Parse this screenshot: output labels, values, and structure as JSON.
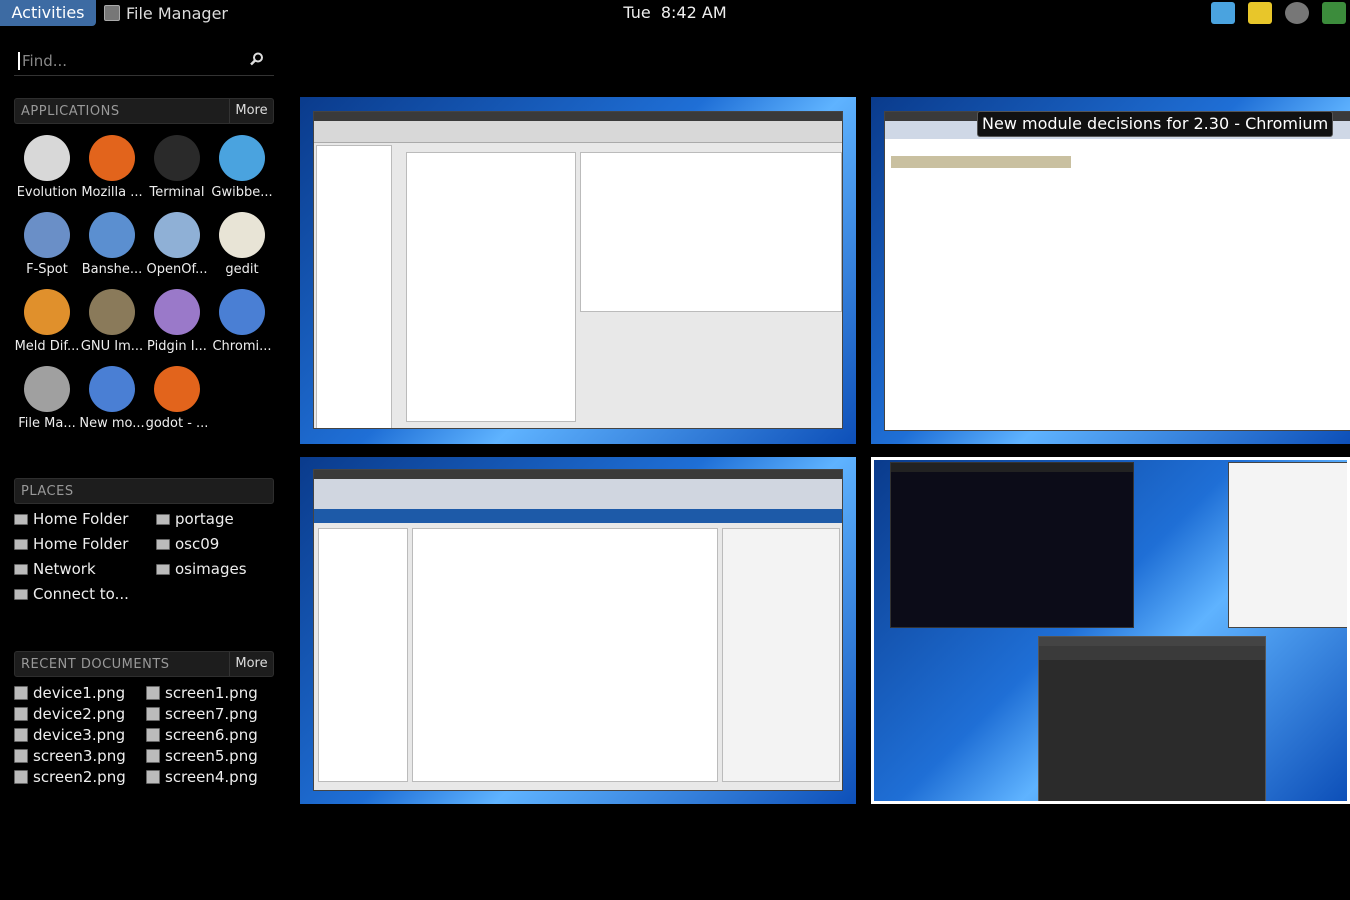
{
  "topbar": {
    "activities": "Activities",
    "app_menu": "File Manager",
    "day": "Tue",
    "time": "8:42 AM"
  },
  "search": {
    "placeholder": "Find..."
  },
  "applications": {
    "heading": "APPLICATIONS",
    "more": "More",
    "items": [
      {
        "label": "Evolution",
        "icon": "evolution-icon",
        "color": "#d8d8d8"
      },
      {
        "label": "Mozilla ...",
        "icon": "firefox-icon",
        "color": "#e2641c"
      },
      {
        "label": "Terminal",
        "icon": "terminal-icon",
        "color": "#2a2a2a"
      },
      {
        "label": "Gwibbe...",
        "icon": "gwibber-icon",
        "color": "#4aa3df"
      },
      {
        "label": "F-Spot",
        "icon": "fspot-icon",
        "color": "#6a8fc7"
      },
      {
        "label": "Banshe...",
        "icon": "banshee-icon",
        "color": "#5b8fd0"
      },
      {
        "label": "OpenOf...",
        "icon": "openoffice-icon",
        "color": "#8fb0d6"
      },
      {
        "label": "gedit",
        "icon": "gedit-icon",
        "color": "#e8e4d6"
      },
      {
        "label": "Meld Dif...",
        "icon": "meld-icon",
        "color": "#e0902c"
      },
      {
        "label": "GNU Im...",
        "icon": "gimp-icon",
        "color": "#8a7a5a"
      },
      {
        "label": "Pidgin I...",
        "icon": "pidgin-icon",
        "color": "#9a79c9"
      },
      {
        "label": "Chromi...",
        "icon": "chromium-icon",
        "color": "#4a7fd4"
      },
      {
        "label": "File Ma...",
        "icon": "file-manager-icon",
        "color": "#a0a0a0"
      },
      {
        "label": "New mo...",
        "icon": "chromium-icon",
        "color": "#4a7fd4"
      },
      {
        "label": "godot - ...",
        "icon": "firefox-icon",
        "color": "#e2641c"
      }
    ]
  },
  "places": {
    "heading": "PLACES",
    "left": [
      {
        "label": "Home Folder",
        "icon": "home-folder-icon"
      },
      {
        "label": "Home Folder",
        "icon": "home-folder-icon"
      },
      {
        "label": "Network",
        "icon": "network-icon"
      },
      {
        "label": "Connect to...",
        "icon": "connect-icon"
      }
    ],
    "right": [
      {
        "label": "portage",
        "icon": "folder-icon"
      },
      {
        "label": "osc09",
        "icon": "folder-icon"
      },
      {
        "label": "osimages",
        "icon": "folder-icon"
      }
    ]
  },
  "recent": {
    "heading": "RECENT DOCUMENTS",
    "more": "More",
    "left": [
      "device1.png",
      "device2.png",
      "device3.png",
      "screen3.png",
      "screen2.png"
    ],
    "right": [
      "screen1.png",
      "screen7.png",
      "screen6.png",
      "screen5.png",
      "screen4.png"
    ]
  },
  "windows": {
    "tooltip": "New module decisions for 2.30 - Chromium"
  }
}
